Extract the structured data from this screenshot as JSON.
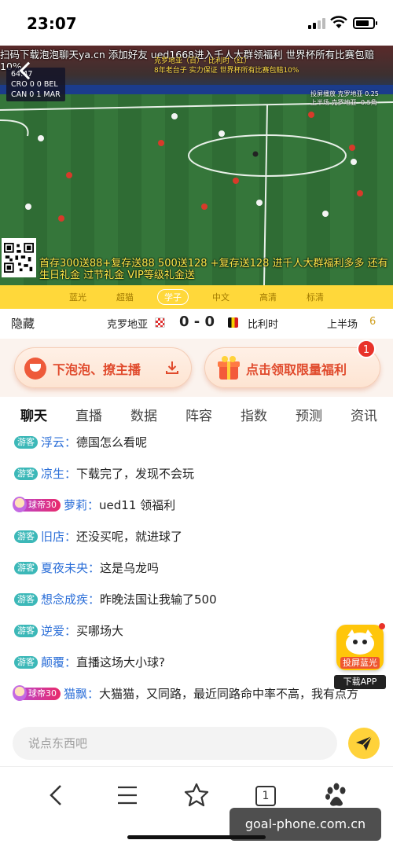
{
  "status_bar": {
    "time": "23:07",
    "battery_level": 0.8
  },
  "video": {
    "top_marquee": "扫码下载泡泡聊天ya.cn 添加好友 ued1668进入千人大群领福利 世界杯所有比赛包赔10%",
    "scorebug": {
      "clock": "64:47",
      "row1": "CRO  0    0  BEL",
      "row2": "CAN  0    1  MAR"
    },
    "overlay_line1": "克罗地亚（百）- 比利时（红）",
    "overlay_line2": "8年老台子 实力保证  世界杯所有比赛包赔10%",
    "broadcast_tag_line1": "投屏播放  克罗地亚 0.25",
    "broadcast_tag_line2": "上半场  克罗地亚 -0.5角",
    "bottom_marquee": "首存300送88+复存送88 500送128 +复存送128 进千人大群福利多多 还有生日礼金 过节礼金 VIP等级礼金送"
  },
  "quality_options": [
    "蓝光",
    "超猫",
    "学子",
    "中文",
    "高清",
    "标清"
  ],
  "quality_active_index": 2,
  "match": {
    "hide_label": "隐藏",
    "team_home": "克罗地亚",
    "score": "0 - 0",
    "team_away": "比利时",
    "period": "上半场",
    "period_value": "6"
  },
  "promo": {
    "left_label": "下泡泡、撩主播",
    "right_label": "点击领取限量福利",
    "badge_count": "1"
  },
  "tabs": [
    "聊天",
    "直播",
    "数据",
    "阵容",
    "指数",
    "预测",
    "资讯"
  ],
  "active_tab_index": 0,
  "chat": {
    "guest_badge": "游客",
    "vip_badge": "球帝30",
    "messages": [
      {
        "user": "浮云：",
        "text": "德国怎么看呢",
        "vip": false
      },
      {
        "user": "凉生：",
        "text": "下载完了，发现不会玩",
        "vip": false
      },
      {
        "user": "萝莉：",
        "text": "ued11 领福利",
        "vip": true
      },
      {
        "user": "旧店：",
        "text": "还没买呢，就进球了",
        "vip": false
      },
      {
        "user": "夏夜未央：",
        "text": "这是乌龙吗",
        "vip": false
      },
      {
        "user": "想念成疾：",
        "text": "昨晚法国让我输了500",
        "vip": false
      },
      {
        "user": "逆爱：",
        "text": "买哪场大",
        "vip": false
      },
      {
        "user": "颠覆：",
        "text": "直播这场大小球?",
        "vip": false
      },
      {
        "user": "猫飘：",
        "text": "大猫猫，又同路，最近同路命中率不高，我有点方",
        "vip": true
      }
    ]
  },
  "float_app": {
    "cast_label": "投屏蓝光",
    "download_label": "下载APP"
  },
  "input": {
    "placeholder": "说点东西吧"
  },
  "browser": {
    "tab_count": "1"
  },
  "watermark": "goal-phone.com.cn"
}
